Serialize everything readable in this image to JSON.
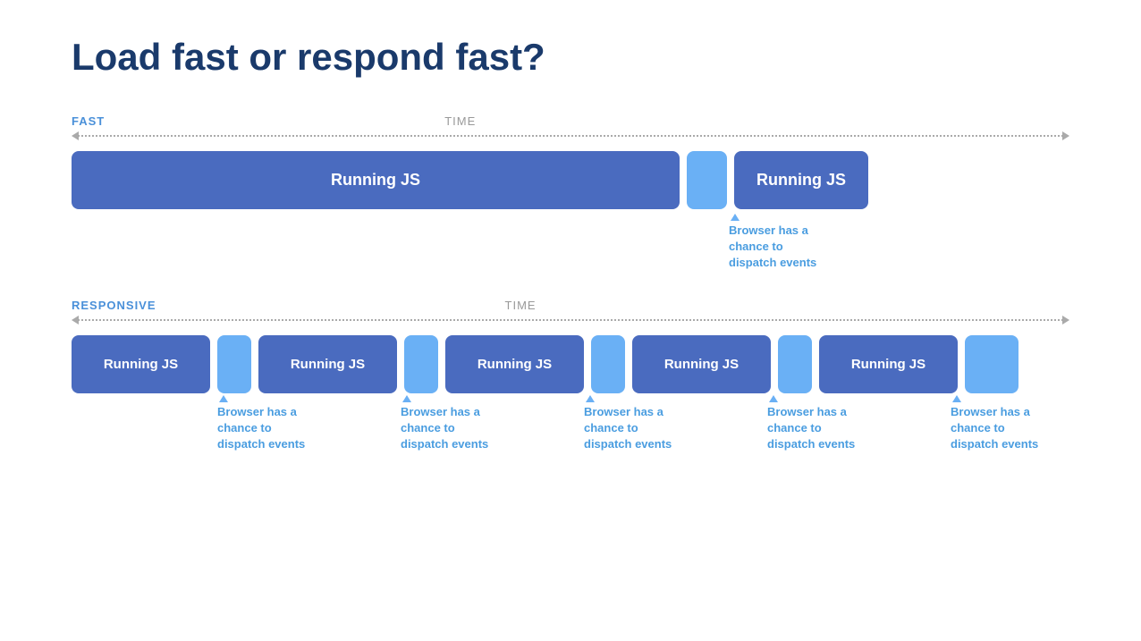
{
  "title": "Load fast or respond fast?",
  "fast_section": {
    "label": "FAST",
    "time_label": "TIME",
    "running_js_large": "Running JS",
    "running_js_medium": "Running JS",
    "annotation": "Browser has a\nchance to\ndispatch events"
  },
  "responsive_section": {
    "label": "RESPONSIVE",
    "time_label": "TIME",
    "running_js_blocks": [
      "Running JS",
      "Running JS",
      "Running JS",
      "Running JS",
      "Running JS"
    ],
    "annotations": [
      "Browser has a\nchance to\ndispatch events",
      "Browser has a\nchance to\ndispatch events",
      "Browser has a\nchance to\ndispatch events",
      "Browser has a\nchance to\ndispatch events",
      "Browser has a\nchance to\ndispatch events"
    ]
  }
}
